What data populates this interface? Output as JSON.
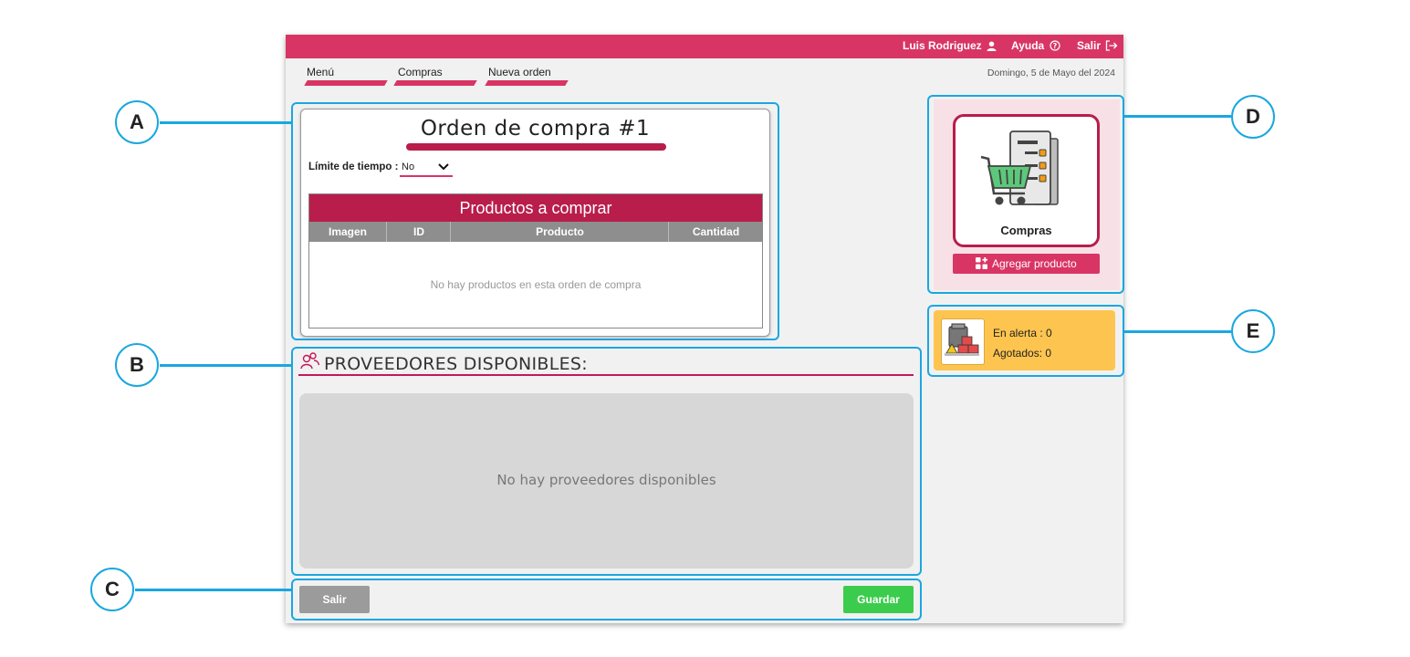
{
  "header": {
    "user_name": "Luis Rodriguez",
    "help_label": "Ayuda",
    "exit_label": "Salir"
  },
  "breadcrumbs": [
    "Menú",
    "Compras",
    "Nueva orden"
  ],
  "date": "Domingo, 5 de Mayo del 2024",
  "order": {
    "title": "Orden de compra #1",
    "time_limit_label": "Límite de tiempo :",
    "time_limit_value": "No",
    "products_header": "Productos a comprar",
    "columns": [
      "Imagen",
      "ID",
      "Producto",
      "Cantidad"
    ],
    "empty_message": "No hay productos en esta orden de compra"
  },
  "providers": {
    "title": "PROVEEDORES DISPONIBLES:",
    "empty_message": "No hay proveedores disponibles"
  },
  "buttons": {
    "exit": "Salir",
    "save": "Guardar"
  },
  "side_card": {
    "tile_label": "Compras",
    "add_product_label": "Agregar producto"
  },
  "alerts": {
    "alert_text": "En alerta : 0",
    "sold_out_text": "Agotados: 0"
  },
  "callouts": [
    "A",
    "B",
    "C",
    "D",
    "E"
  ],
  "colors": {
    "brand": "#d83565",
    "brand_dark": "#b81d4b",
    "save_green": "#3ccc4d",
    "alert_yellow": "#fdc54f",
    "annotation_blue": "#1aa7e0"
  }
}
